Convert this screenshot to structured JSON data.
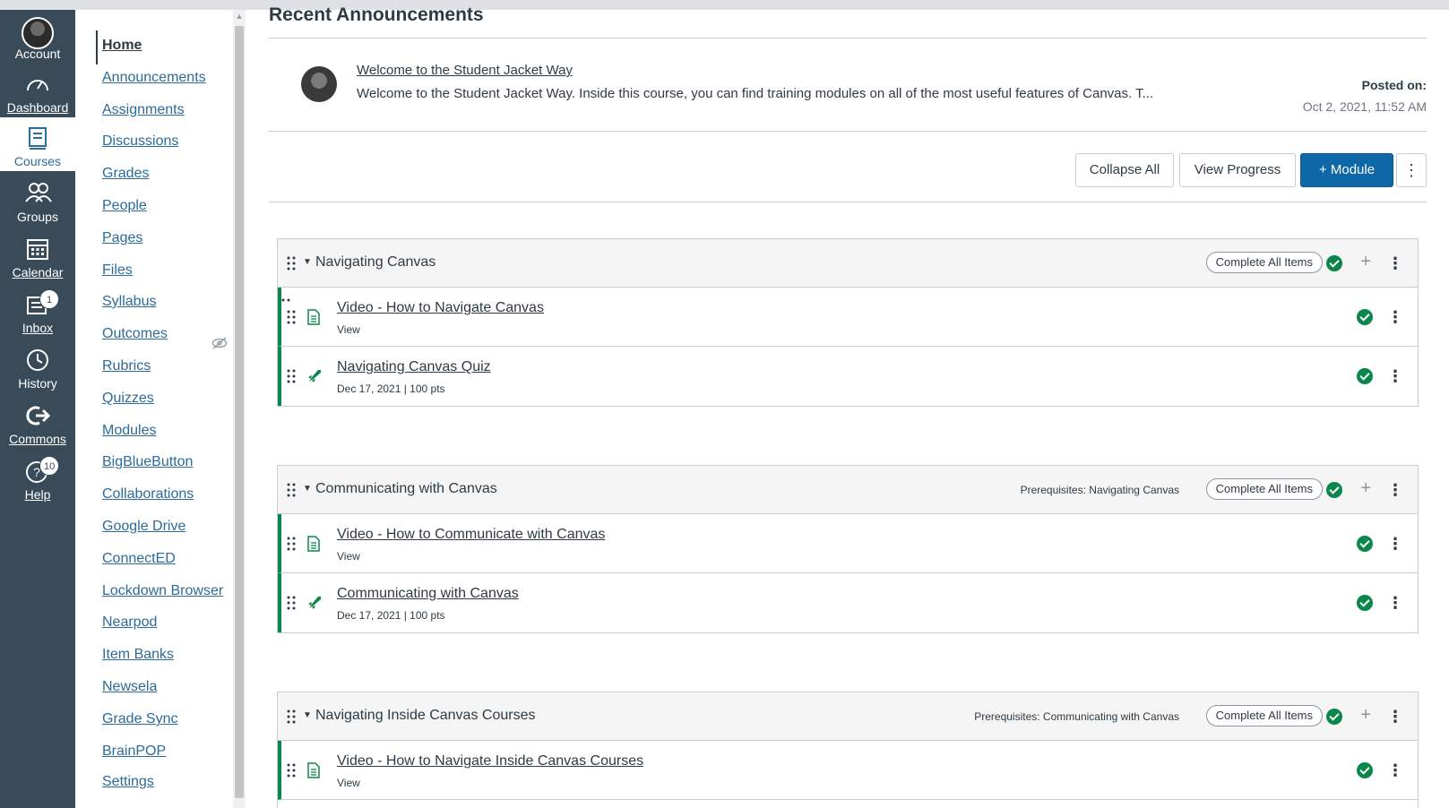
{
  "global_nav": {
    "items": [
      {
        "label": "Account",
        "icon": "account-avatar",
        "underline": false
      },
      {
        "label": "Dashboard",
        "icon": "dashboard-icon",
        "underline": true
      },
      {
        "label": "Courses",
        "icon": "courses-icon",
        "underline": false
      },
      {
        "label": "Groups",
        "icon": "groups-icon",
        "underline": false
      },
      {
        "label": "Calendar",
        "icon": "calendar-icon",
        "underline": true
      },
      {
        "label": "Inbox",
        "icon": "inbox-icon",
        "underline": true,
        "badge": "1"
      },
      {
        "label": "History",
        "icon": "history-icon",
        "underline": false
      },
      {
        "label": "Commons",
        "icon": "commons-icon",
        "underline": true
      },
      {
        "label": "Help",
        "icon": "help-icon",
        "underline": true,
        "badge": "10"
      }
    ],
    "colors": {
      "background": "#394b58",
      "active_text": "#2d6b99"
    }
  },
  "course_nav": {
    "items": [
      {
        "label": "Home",
        "active": true
      },
      {
        "label": "Announcements"
      },
      {
        "label": "Assignments"
      },
      {
        "label": "Discussions"
      },
      {
        "label": "Grades"
      },
      {
        "label": "People"
      },
      {
        "label": "Pages"
      },
      {
        "label": "Files"
      },
      {
        "label": "Syllabus"
      },
      {
        "label": "Outcomes",
        "hidden_icon": "eye-slash-icon"
      },
      {
        "label": "Rubrics"
      },
      {
        "label": "Quizzes"
      },
      {
        "label": "Modules"
      },
      {
        "label": "BigBlueButton"
      },
      {
        "label": "Collaborations"
      },
      {
        "label": "Google Drive"
      },
      {
        "label": "ConnectED"
      },
      {
        "label": "Lockdown Browser"
      },
      {
        "label": "Nearpod"
      },
      {
        "label": "Item Banks"
      },
      {
        "label": "Newsela"
      },
      {
        "label": "Grade Sync"
      },
      {
        "label": "BrainPOP"
      },
      {
        "label": "Settings"
      }
    ]
  },
  "announcements": {
    "heading": "Recent Announcements",
    "items": [
      {
        "title": "Welcome to the Student Jacket Way",
        "body": "Welcome to the Student Jacket Way.  Inside this course, you can find training modules on all of the most useful features of Canvas. T...",
        "posted_label": "Posted on:",
        "posted_date": "Oct 2, 2021, 11:52 AM"
      }
    ]
  },
  "toolbar": {
    "collapse_all": "Collapse All",
    "view_progress": "View Progress",
    "add_module": "+ Module",
    "more": "⋮"
  },
  "modules": [
    {
      "title": "Navigating Canvas",
      "prerequisites": "",
      "complete_label": "Complete All Items",
      "items": [
        {
          "title": "Video - How to Navigate Canvas",
          "subtitle": "View",
          "type": "page"
        },
        {
          "title": "Navigating Canvas Quiz",
          "subtitle": "Dec 17, 2021  |  100 pts",
          "type": "quiz"
        }
      ]
    },
    {
      "title": "Communicating with Canvas",
      "prerequisites": "Prerequisites: Navigating Canvas",
      "complete_label": "Complete All Items",
      "items": [
        {
          "title": "Video - How to Communicate with Canvas",
          "subtitle": "View",
          "type": "page"
        },
        {
          "title": "Communicating with Canvas",
          "subtitle": "Dec 17, 2021  |  100 pts",
          "type": "quiz"
        }
      ]
    },
    {
      "title": "Navigating Inside Canvas Courses",
      "prerequisites": "Prerequisites: Communicating with Canvas",
      "complete_label": "Complete All Items",
      "items": [
        {
          "title": "Video - How to Navigate Inside Canvas Courses",
          "subtitle": "View",
          "type": "page"
        }
      ]
    }
  ],
  "colors": {
    "accent": "#0e68a8",
    "success": "#0b874b",
    "link": "#2d6b99"
  }
}
